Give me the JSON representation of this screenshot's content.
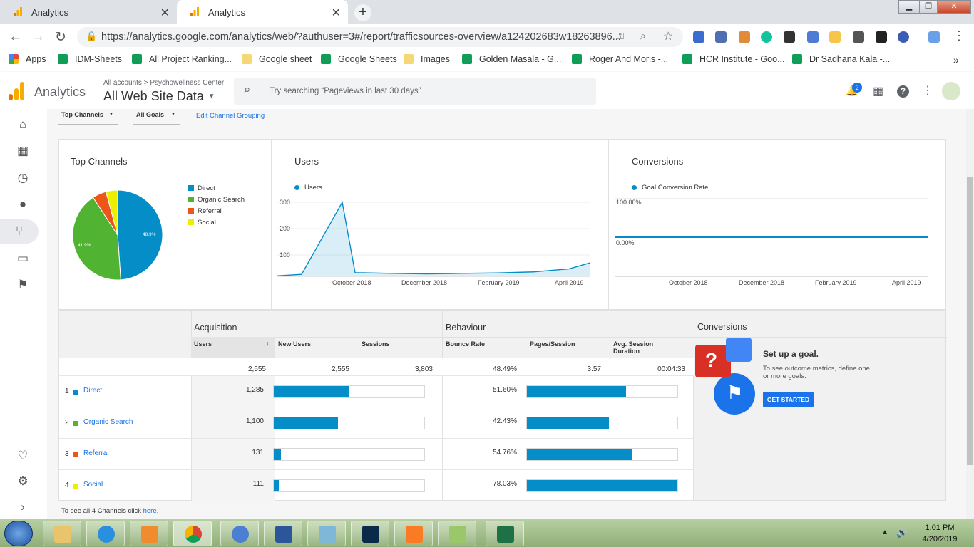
{
  "browser": {
    "tabs": [
      {
        "title": "Analytics",
        "active": false
      },
      {
        "title": "Analytics",
        "active": true
      }
    ],
    "new_tab_label": "+",
    "url": "https://analytics.google.com/analytics/web/?authuser=3#/report/trafficsources-overview/a124202683w18263896...",
    "bookmarks": [
      {
        "label": "Apps"
      },
      {
        "label": "IDM-Sheets"
      },
      {
        "label": "All Project Ranking..."
      },
      {
        "label": "Google sheet"
      },
      {
        "label": "Google Sheets"
      },
      {
        "label": "Images"
      },
      {
        "label": "Golden Masala - G..."
      },
      {
        "label": "Roger And Moris -..."
      },
      {
        "label": "HCR Institute - Goo..."
      },
      {
        "label": "Dr Sadhana Kala -..."
      }
    ],
    "bookmarks_more": "»"
  },
  "ga": {
    "product": "Analytics",
    "breadcrumb": "All accounts > Psychowellness Center",
    "property": "All Web Site Data",
    "search_placeholder": "Try searching “Pageviews in last 30 days”",
    "notification_count": "2"
  },
  "controls": {
    "top_channels": "Top Channels",
    "all_goals": "All Goals",
    "edit_grouping": "Edit Channel Grouping"
  },
  "pie": {
    "title": "Top Channels",
    "legend": [
      {
        "label": "Direct",
        "color": "#058dc7"
      },
      {
        "label": "Organic Search",
        "color": "#50b432"
      },
      {
        "label": "Referral",
        "color": "#ed561b"
      },
      {
        "label": "Social",
        "color": "#edef00"
      }
    ],
    "labels": {
      "direct": "48.9%",
      "organic": "41.9%"
    }
  },
  "users_chart": {
    "title": "Users",
    "legend": "Users",
    "yticks": [
      "300",
      "200",
      "100"
    ],
    "xticks": [
      "October 2018",
      "December 2018",
      "February 2019",
      "April 2019"
    ],
    "color": "#058dc7"
  },
  "conv_chart": {
    "title": "Conversions",
    "legend": "Goal Conversion Rate",
    "yticks": [
      "100.00%",
      "0.00%"
    ],
    "xticks": [
      "October 2018",
      "December 2018",
      "February 2019",
      "April 2019"
    ]
  },
  "chart_data": [
    {
      "type": "pie",
      "title": "Top Channels",
      "categories": [
        "Direct",
        "Organic Search",
        "Referral",
        "Social"
      ],
      "values": [
        48.9,
        41.9,
        5.0,
        4.2
      ]
    },
    {
      "type": "line",
      "title": "Users",
      "x": [
        "2018-08",
        "2018-09",
        "2018-09-20",
        "2018-10",
        "2018-11",
        "2018-12",
        "2019-01",
        "2019-02",
        "2019-03",
        "2019-04",
        "2019-04-20"
      ],
      "series": [
        {
          "name": "Users",
          "values": [
            2,
            8,
            300,
            15,
            12,
            10,
            12,
            14,
            18,
            30,
            55
          ]
        }
      ],
      "ylim": [
        0,
        300
      ]
    },
    {
      "type": "line",
      "title": "Conversions",
      "series": [
        {
          "name": "Goal Conversion Rate",
          "values": [
            0,
            0,
            0,
            0
          ]
        }
      ],
      "x": [
        "October 2018",
        "December 2018",
        "February 2019",
        "April 2019"
      ],
      "ylim": [
        0,
        100
      ]
    }
  ],
  "table": {
    "section_acq": "Acquisition",
    "section_beh": "Behaviour",
    "section_conv": "Conversions",
    "headers": {
      "users": "Users",
      "new_users": "New Users",
      "sessions": "Sessions",
      "bounce": "Bounce Rate",
      "pages": "Pages/Session",
      "duration": "Avg. Session Duration"
    },
    "totals": {
      "users": "2,555",
      "new_users": "2,555",
      "sessions": "3,803",
      "bounce": "48.49%",
      "pages": "3.57",
      "duration": "00:04:33"
    },
    "rows": [
      {
        "idx": "1",
        "label": "Direct",
        "color": "#058dc7",
        "users": "1,285",
        "bounce": "51.60%",
        "user_frac": 1.0,
        "bounce_frac": 0.66
      },
      {
        "idx": "2",
        "label": "Organic Search",
        "color": "#50b432",
        "users": "1,100",
        "bounce": "42.43%",
        "user_frac": 0.856,
        "bounce_frac": 0.543
      },
      {
        "idx": "3",
        "label": "Referral",
        "color": "#ed561b",
        "users": "131",
        "bounce": "54.76%",
        "user_frac": 0.09,
        "bounce_frac": 0.7
      },
      {
        "idx": "4",
        "label": "Social",
        "color": "#edef00",
        "users": "111",
        "bounce": "78.03%",
        "user_frac": 0.07,
        "bounce_frac": 1.0
      }
    ],
    "footer_prefix": "To see all 4 Channels click",
    "footer_link": "here."
  },
  "goal": {
    "title": "Set up a goal.",
    "desc": "To see outcome metrics, define one or more goals.",
    "button": "GET STARTED"
  },
  "taskbar": {
    "time": "1:01 PM",
    "date": "4/20/2019"
  }
}
